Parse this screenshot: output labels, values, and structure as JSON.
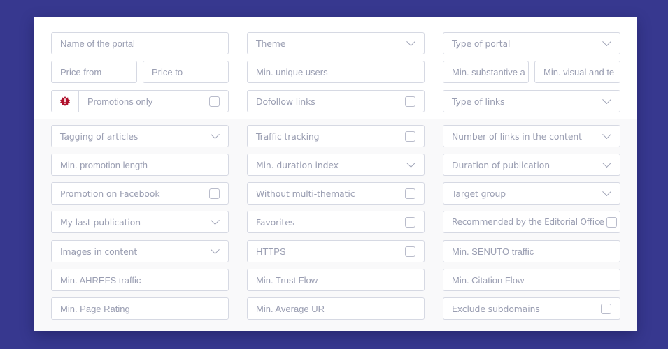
{
  "filters": {
    "col1": {
      "name_of_portal": "Name of the portal",
      "price_from": "Price from",
      "price_to": "Price to",
      "promotions_only": "Promotions only",
      "tagging_of_articles": "Tagging of articles",
      "min_promotion_length": "Min. promotion length",
      "promotion_on_facebook": "Promotion on Facebook",
      "my_last_publication": "My last publication",
      "images_in_content": "Images in content",
      "min_ahrefs_traffic": "Min. AHREFS traffic",
      "min_page_rating": "Min. Page Rating"
    },
    "col2": {
      "theme": "Theme",
      "min_unique_users": "Min. unique users",
      "dofollow_links": "Dofollow links",
      "traffic_tracking": "Traffic tracking",
      "min_duration_index": "Min. duration index",
      "without_multi_thematic": "Without multi-thematic",
      "favorites": "Favorites",
      "https": "HTTPS",
      "min_trust_flow": "Min. Trust Flow",
      "min_average_ur": "Min. Average UR"
    },
    "col3": {
      "type_of_portal": "Type of portal",
      "min_substantive": "Min. substantive a",
      "min_visual_and_text": "Min. visual and te",
      "type_of_links": "Type of links",
      "number_of_links": "Number of links in the content",
      "duration_of_publication": "Duration of publication",
      "target_group": "Target group",
      "recommended_by_editorial": "Recommended by the Editorial Office",
      "min_senuto_traffic": "Min. SENUTO traffic",
      "min_citation_flow": "Min. Citation Flow",
      "exclude_subdomains": "Exclude subdomains"
    }
  },
  "icons": {
    "promotion": "alert-badge-icon"
  },
  "colors": {
    "background": "#37388f",
    "promotion_icon": "#b0102c",
    "field_border": "#d6d9e3",
    "placeholder_text": "#9a9eb2"
  }
}
